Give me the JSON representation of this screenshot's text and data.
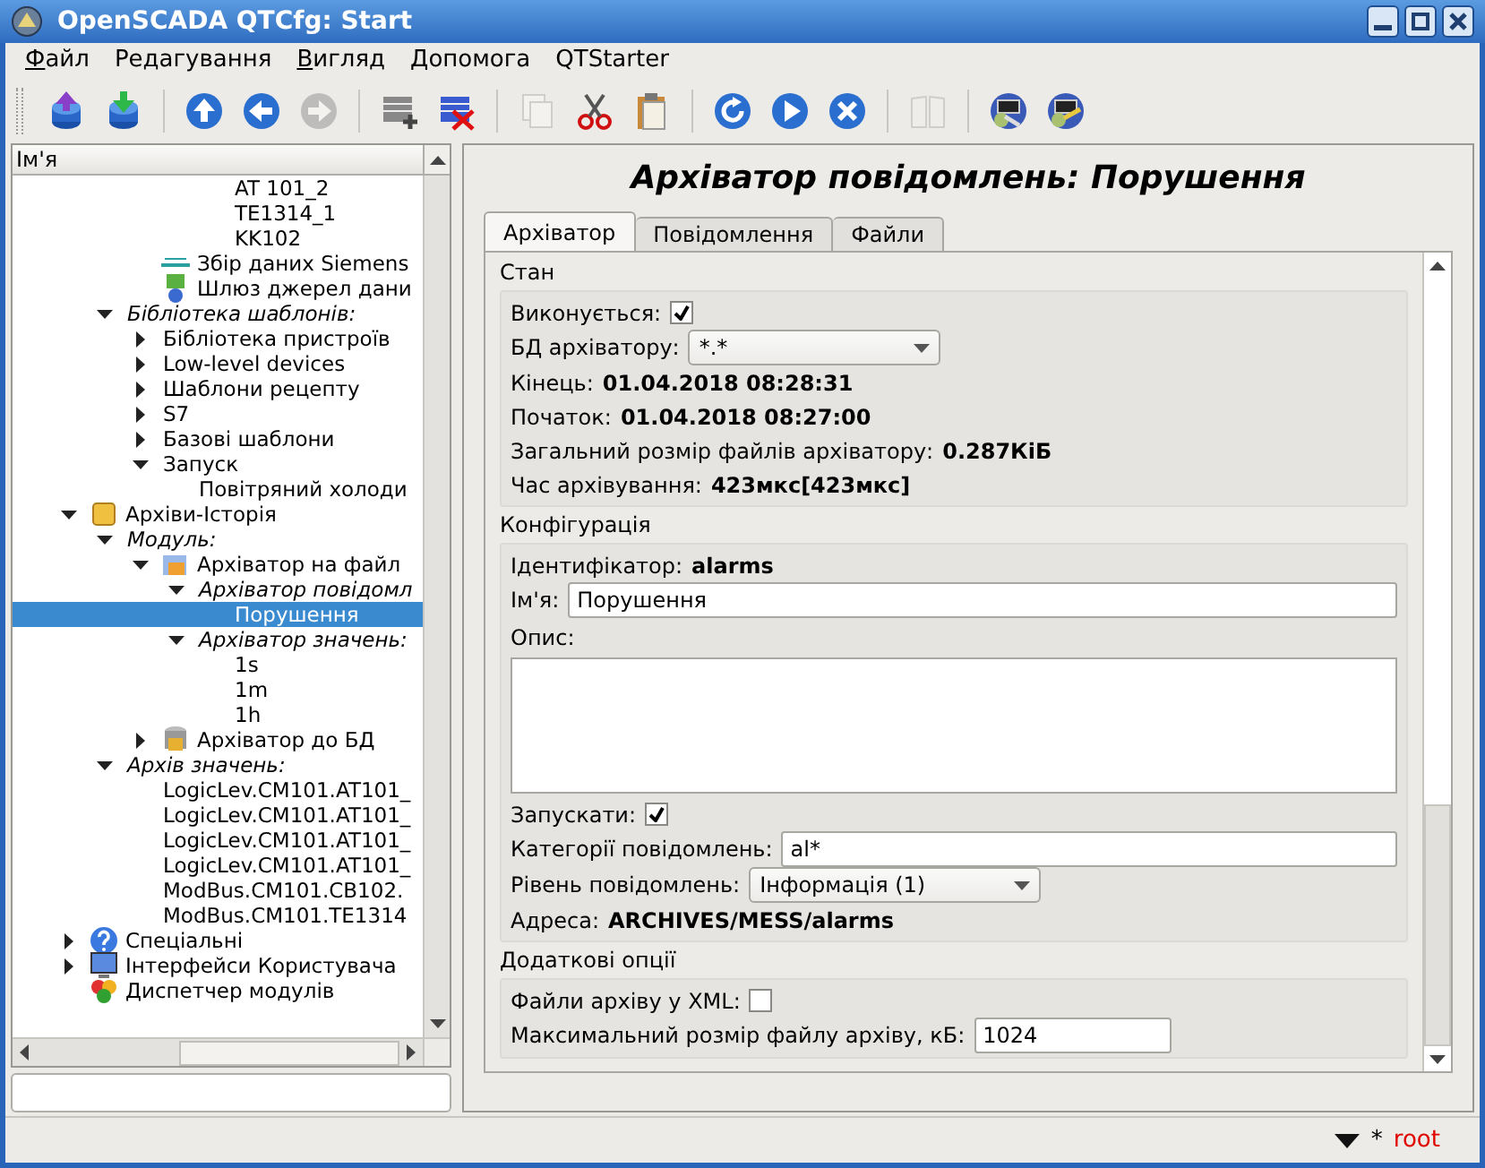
{
  "window": {
    "title": "OpenSCADA QTCfg: Start"
  },
  "menu": [
    {
      "label": "Файл",
      "mnemonic": true
    },
    {
      "label": "Редагування",
      "mnemonic": false
    },
    {
      "label": "Вигляд",
      "mnemonic": true
    },
    {
      "label": "Допомога",
      "mnemonic": true
    },
    {
      "label": "QTStarter",
      "mnemonic": false
    }
  ],
  "toolbar": {
    "groups": [
      [
        {
          "disabled": false
        },
        {
          "disabled": false
        }
      ],
      [
        {
          "disabled": false
        },
        {
          "disabled": false
        },
        {
          "disabled": true
        }
      ],
      [
        {
          "disabled": false
        },
        {
          "disabled": false
        }
      ],
      [
        {
          "disabled": true
        },
        {
          "disabled": false
        },
        {
          "disabled": false
        }
      ],
      [
        {
          "disabled": false
        },
        {
          "disabled": false
        },
        {
          "disabled": false
        }
      ],
      [
        {
          "disabled": true
        }
      ],
      [
        {
          "disabled": false
        },
        {
          "disabled": false
        }
      ]
    ]
  },
  "tree": {
    "header": "Ім'я",
    "items": [
      {
        "children": [
          {
            "children": [
              {
                "children": [
                  {
                    "children": [
                      {
                        "label": "AT 101_2",
                        "kind": "item",
                        "selected": false
                      },
                      {
                        "label": "TE1314_1",
                        "kind": "item",
                        "selected": false
                      },
                      {
                        "label": "KK102",
                        "kind": "item",
                        "selected": false
                      }
                    ]
                  }
                ]
              },
              {
                "label": "Збір даних Siemens",
                "kind": "item",
                "selected": false
              },
              {
                "label": "Шлюз джерел дани",
                "kind": "item",
                "selected": false
              }
            ]
          },
          {
            "label": "Бібліотека шаблонів:",
            "kind": "category",
            "selected": false,
            "expanded": true,
            "children": [
              {
                "label": "Бібліотека пристроїв",
                "kind": "item",
                "selected": false,
                "expanded": false
              },
              {
                "label": "Low-level devices",
                "kind": "item",
                "selected": false,
                "expanded": false
              },
              {
                "label": "Шаблони рецепту",
                "kind": "item",
                "selected": false,
                "expanded": false
              },
              {
                "label": "S7",
                "kind": "item",
                "selected": false,
                "expanded": false
              },
              {
                "label": "Базові шаблони",
                "kind": "item",
                "selected": false,
                "expanded": false
              },
              {
                "label": "Запуск",
                "kind": "item",
                "selected": false,
                "expanded": true,
                "children": [
                  {
                    "label": "Повітряний холоди",
                    "kind": "item",
                    "selected": false
                  }
                ]
              }
            ]
          }
        ]
      },
      {
        "label": "Архіви-Історія",
        "kind": "item",
        "selected": false,
        "expanded": true,
        "children": [
          {
            "label": "Модуль:",
            "kind": "category",
            "selected": false,
            "expanded": true,
            "children": [
              {
                "label": "Архіватор на файл",
                "kind": "item",
                "selected": false,
                "expanded": true,
                "children": [
                  {
                    "label": "Архіватор повідомл",
                    "kind": "category",
                    "selected": false,
                    "expanded": true,
                    "children": [
                      {
                        "label": "Порушення",
                        "kind": "item",
                        "selected": true
                      }
                    ]
                  },
                  {
                    "label": "Архіватор значень:",
                    "kind": "category",
                    "selected": false,
                    "expanded": true,
                    "children": [
                      {
                        "label": "1s",
                        "kind": "item",
                        "selected": false
                      },
                      {
                        "label": "1m",
                        "kind": "item",
                        "selected": false
                      },
                      {
                        "label": "1h",
                        "kind": "item",
                        "selected": false
                      }
                    ]
                  }
                ]
              },
              {
                "label": "Архіватор до БД",
                "kind": "item",
                "selected": false,
                "expanded": false
              }
            ]
          },
          {
            "label": "Архів значень:",
            "kind": "category",
            "selected": false,
            "expanded": true,
            "children": [
              {
                "label": "LogicLev.CM101.AT101_",
                "kind": "item",
                "selected": false
              },
              {
                "label": "LogicLev.CM101.AT101_",
                "kind": "item",
                "selected": false
              },
              {
                "label": "LogicLev.CM101.AT101_",
                "kind": "item",
                "selected": false
              },
              {
                "label": "LogicLev.CM101.AT101_",
                "kind": "item",
                "selected": false
              },
              {
                "label": "ModBus.CM101.CB102.",
                "kind": "item",
                "selected": false
              },
              {
                "label": "ModBus.CM101.TE1314",
                "kind": "item",
                "selected": false
              }
            ]
          }
        ]
      },
      {
        "label": "Спеціальні",
        "kind": "item",
        "selected": false,
        "expanded": false
      },
      {
        "label": "Інтерфейси Користувача",
        "kind": "item",
        "selected": false,
        "expanded": false
      },
      {
        "label": "Диспетчер модулів",
        "kind": "item",
        "selected": false
      }
    ]
  },
  "panel": {
    "title": "Архіватор повідомлень: Порушення",
    "tabs": [
      {
        "label": "Архіватор",
        "selected": true
      },
      {
        "label": "Повідомлення",
        "selected": false
      },
      {
        "label": "Файли",
        "selected": false
      }
    ],
    "sections": [
      {
        "title": "Стан",
        "rows": [
          {
            "kind": "checkbox",
            "label": "Виконується:",
            "checked": true
          },
          {
            "kind": "select",
            "label": "БД архіватору:",
            "value": "*.*"
          },
          {
            "kind": "info",
            "label": "Кінець:",
            "value": "01.04.2018 08:28:31"
          },
          {
            "kind": "info",
            "label": "Початок:",
            "value": "01.04.2018 08:27:00"
          },
          {
            "kind": "info",
            "label": "Загальний розмір файлів архіватору:",
            "value": "0.287КіБ"
          },
          {
            "kind": "info",
            "label": "Час архівування:",
            "value": "423мкс[423мкс]"
          }
        ]
      },
      {
        "title": "Конфігурація",
        "rows": [
          {
            "kind": "info",
            "label": "Ідентифікатор:",
            "value": "alarms"
          },
          {
            "kind": "input",
            "label": "Ім'я:",
            "value": "Порушення"
          },
          {
            "kind": "textarea",
            "label": "Опис:"
          },
          {
            "kind": "checkbox",
            "label": "Запускати:",
            "checked": true
          },
          {
            "kind": "input",
            "label": "Категорії повідомлень:",
            "value": "al*"
          },
          {
            "kind": "select",
            "label": "Рівень повідомлень:",
            "value": "Інформація (1)"
          },
          {
            "kind": "info",
            "label": "Адреса:",
            "value": "ARCHIVES/MESS/alarms"
          }
        ]
      },
      {
        "title": "Додаткові опції",
        "rows": [
          {
            "kind": "checkbox",
            "label": "Файли архіву у XML:",
            "checked": false
          },
          {
            "kind": "short_input",
            "label": "Максимальний розмір файлу архіву, кБ:",
            "value": "1024"
          }
        ]
      }
    ]
  },
  "status_bar": {
    "mode": "*",
    "user": "root"
  }
}
